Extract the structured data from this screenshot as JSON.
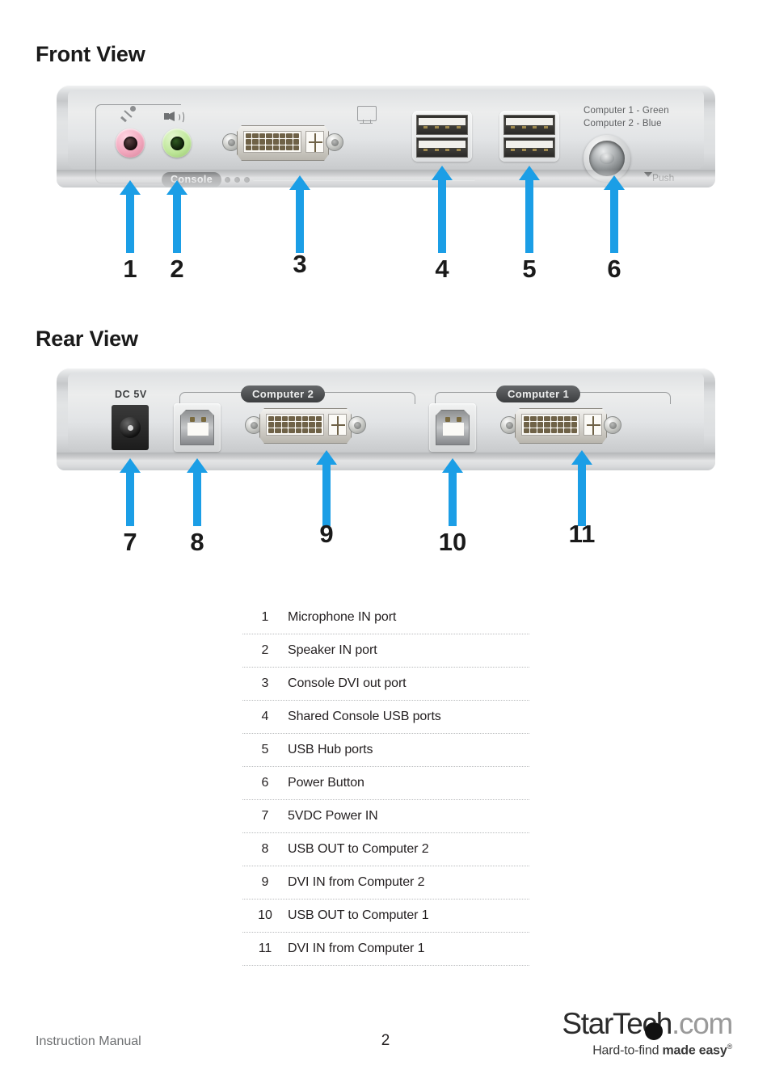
{
  "document": {
    "front_view_heading": "Front View",
    "rear_view_heading": "Rear View"
  },
  "front_panel": {
    "console_badge": "Console",
    "switch_note_line1": "Computer 1 - Green",
    "switch_note_line2": "Computer 2 - Blue",
    "push_label": "Push",
    "callouts": [
      {
        "number": "1"
      },
      {
        "number": "2"
      },
      {
        "number": "3"
      },
      {
        "number": "4"
      },
      {
        "number": "5"
      },
      {
        "number": "6"
      }
    ]
  },
  "rear_panel": {
    "dc_label": "DC 5V",
    "computer2_badge": "Computer 2",
    "computer1_badge": "Computer 1",
    "callouts": [
      {
        "number": "7"
      },
      {
        "number": "8"
      },
      {
        "number": "9"
      },
      {
        "number": "10"
      },
      {
        "number": "11"
      }
    ]
  },
  "legend": {
    "rows": [
      {
        "number": "1",
        "description": "Microphone IN port"
      },
      {
        "number": "2",
        "description": "Speaker IN port"
      },
      {
        "number": "3",
        "description": "Console DVI out port"
      },
      {
        "number": "4",
        "description": "Shared Console USB ports"
      },
      {
        "number": "5",
        "description": "USB Hub ports"
      },
      {
        "number": "6",
        "description": "Power Button"
      },
      {
        "number": "7",
        "description": "5VDC Power IN"
      },
      {
        "number": "8",
        "description": "USB OUT to Computer 2"
      },
      {
        "number": "9",
        "description": "DVI IN from Computer 2"
      },
      {
        "number": "10",
        "description": "USB OUT to Computer 1"
      },
      {
        "number": "11",
        "description": "DVI IN from Computer 1"
      }
    ]
  },
  "footer": {
    "manual_label": "Instruction Manual",
    "page_number": "2",
    "logo_part1": "StarTech",
    "logo_part2": ".com",
    "tagline_light": "Hard-to-find ",
    "tagline_bold": "made easy",
    "tagline_mark": "®"
  },
  "colors": {
    "accent_arrow": "#1b9ee6",
    "mic_jack": "#f2a7bd",
    "speaker_jack": "#bfe79a",
    "text": "#231f20"
  }
}
